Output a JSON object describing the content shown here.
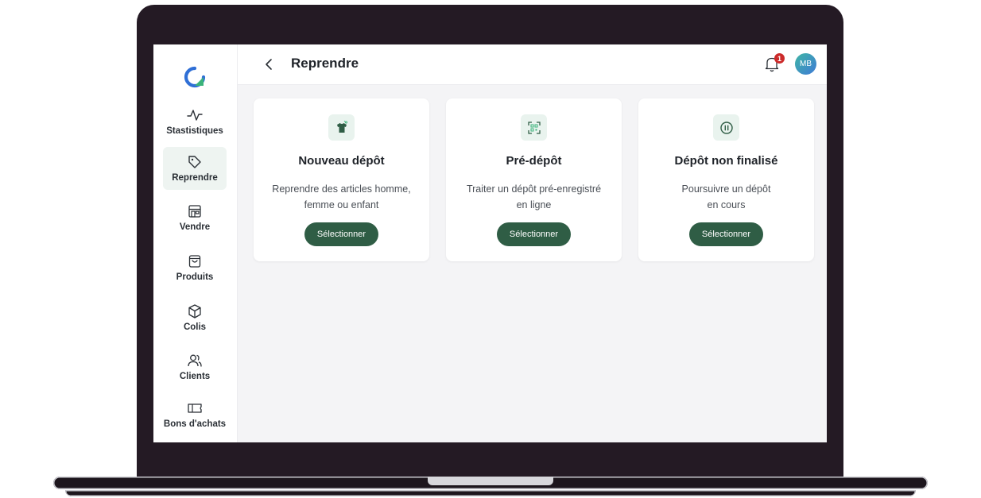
{
  "app": {
    "title": "Reprendre",
    "notifications_count": "1",
    "user_initials": "MB",
    "brand_color": "#2f5d45",
    "accent_color": "#cc2a2a"
  },
  "sidebar": {
    "logo_icon": "logo-icon",
    "items": [
      {
        "label": "Stastistiques",
        "icon": "activity-icon",
        "active": false
      },
      {
        "label": "Reprendre",
        "icon": "tag-icon",
        "active": true
      },
      {
        "label": "Vendre",
        "icon": "store-icon",
        "active": false
      },
      {
        "label": "Produits",
        "icon": "bag-icon",
        "active": false
      },
      {
        "label": "Colis",
        "icon": "box-icon",
        "active": false
      },
      {
        "label": "Clients",
        "icon": "users-icon",
        "active": false
      },
      {
        "label": "Bons d'achats",
        "icon": "ticket-icon",
        "active": false
      }
    ]
  },
  "cards": [
    {
      "icon": "shirt-icon",
      "title": "Nouveau dépôt",
      "desc_line1": "Reprendre des articles homme,",
      "desc_line2": "femme ou enfant",
      "button": "Sélectionner"
    },
    {
      "icon": "scan-icon",
      "title": "Pré-dépôt",
      "desc_line1": "Traiter un dépôt pré-enregistré",
      "desc_line2": "en ligne",
      "button": "Sélectionner"
    },
    {
      "icon": "pause-icon",
      "title": "Dépôt non finalisé",
      "desc_line1": "Poursuivre un dépôt",
      "desc_line2": "en cours",
      "button": "Sélectionner"
    }
  ]
}
